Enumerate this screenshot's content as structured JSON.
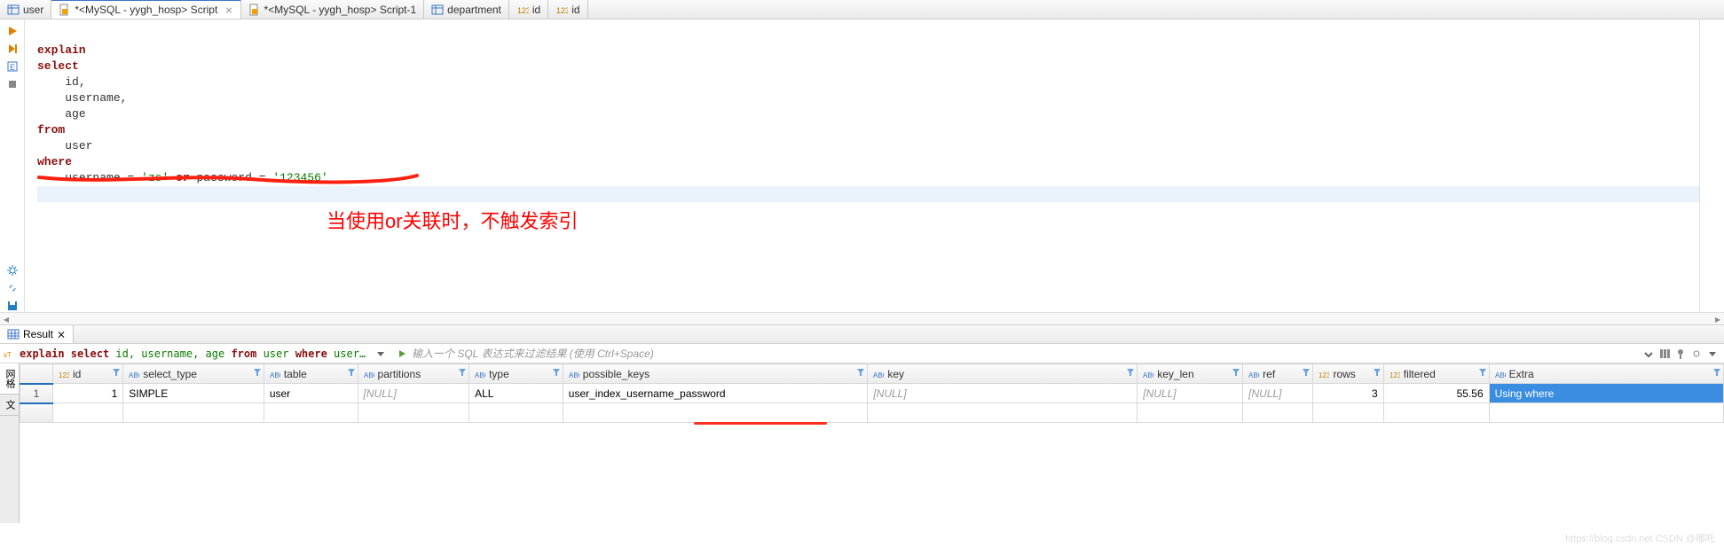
{
  "tabs": [
    {
      "label": "user",
      "type": "table"
    },
    {
      "label": "*<MySQL - yygh_hosp> Script",
      "type": "sql",
      "active": true
    },
    {
      "label": "*<MySQL - yygh_hosp> Script-1",
      "type": "sql"
    },
    {
      "label": "department",
      "type": "table"
    },
    {
      "label": "id",
      "type": "col"
    },
    {
      "label": "id",
      "type": "col"
    }
  ],
  "sql": {
    "l1": "explain",
    "l2": "select",
    "l3": "id,",
    "l4": "username,",
    "l5": "age",
    "l6": "from",
    "l7": "user",
    "l8": "where",
    "l9a": "username = ",
    "l9b": "'zs'",
    "l9c": " or ",
    "l9d": "password = ",
    "l9e": "'123456'"
  },
  "annotation": "当使用or关联时，不触发索引",
  "result_tab": "Result",
  "filter_sql": {
    "pre": "explain select",
    "mid": " id, username, age ",
    "from": "from",
    "mid2": " user ",
    "where": "where",
    "rest": " userna"
  },
  "filter_placeholder": "输入一个 SQL 表达式来过滤结果 (使用 Ctrl+Space)",
  "side_tabs": {
    "grid": "网格",
    "text": "文"
  },
  "columns": {
    "rownum_head": "",
    "id": "id",
    "select_type": "select_type",
    "table": "table",
    "partitions": "partitions",
    "type": "type",
    "possible_keys": "possible_keys",
    "key": "key",
    "key_len": "key_len",
    "ref": "ref",
    "rows": "rows",
    "filtered": "filtered",
    "extra": "Extra"
  },
  "row": {
    "num": "1",
    "id": "1",
    "select_type": "SIMPLE",
    "table": "user",
    "partitions": "[NULL]",
    "type": "ALL",
    "possible_keys": "user_index_username_password",
    "key": "[NULL]",
    "key_len": "[NULL]",
    "ref": "[NULL]",
    "rows": "3",
    "filtered": "55.56",
    "extra": "Using where"
  },
  "watermark": "https://blog.csdn.net  CSDN @哪吒"
}
